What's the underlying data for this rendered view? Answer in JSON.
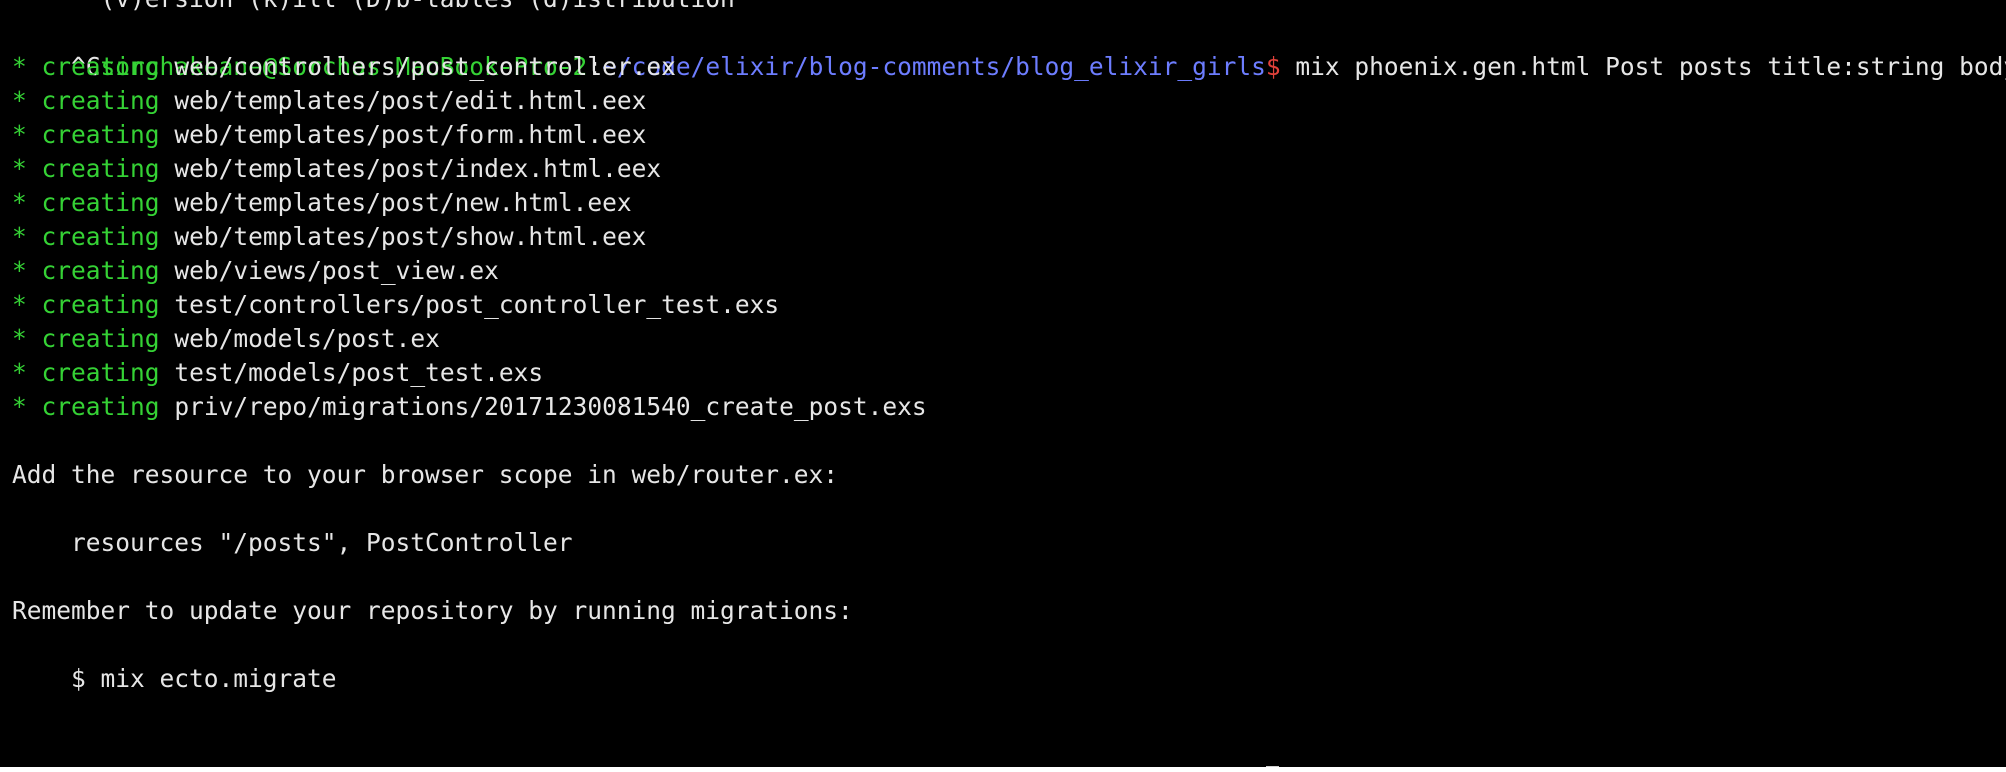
{
  "terminal": {
    "clipped_line": "      (v)ersion (k)ill (D)b-tables (d)istribution",
    "interrupt_marker": "^C",
    "prompt": {
      "user_host": "sorchakeane@Sorchas-MacBook-Pro-2",
      "separator": ":",
      "path": "~/code/elixir/blog-comments/blog_elixir_girls",
      "symbol": "$"
    },
    "command": " mix phoenix.gen.html Post posts title:string body:text",
    "created_files": [
      {
        "star": "*",
        "verb": "creating",
        "path": "web/controllers/post_controller.ex"
      },
      {
        "star": "*",
        "verb": "creating",
        "path": "web/templates/post/edit.html.eex"
      },
      {
        "star": "*",
        "verb": "creating",
        "path": "web/templates/post/form.html.eex"
      },
      {
        "star": "*",
        "verb": "creating",
        "path": "web/templates/post/index.html.eex"
      },
      {
        "star": "*",
        "verb": "creating",
        "path": "web/templates/post/new.html.eex"
      },
      {
        "star": "*",
        "verb": "creating",
        "path": "web/templates/post/show.html.eex"
      },
      {
        "star": "*",
        "verb": "creating",
        "path": "web/views/post_view.ex"
      },
      {
        "star": "*",
        "verb": "creating",
        "path": "test/controllers/post_controller_test.exs"
      },
      {
        "star": "*",
        "verb": "creating",
        "path": "web/models/post.ex"
      },
      {
        "star": "*",
        "verb": "creating",
        "path": "test/models/post_test.exs"
      },
      {
        "star": "*",
        "verb": "creating",
        "path": "priv/repo/migrations/20171230081540_create_post.exs"
      }
    ],
    "instruction_router": "Add the resource to your browser scope in web/router.ex:",
    "router_snippet": "    resources \"/posts\", PostController",
    "instruction_migrate": "Remember to update your repository by running migrations:",
    "migrate_snippet": "    $ mix ecto.migrate"
  }
}
